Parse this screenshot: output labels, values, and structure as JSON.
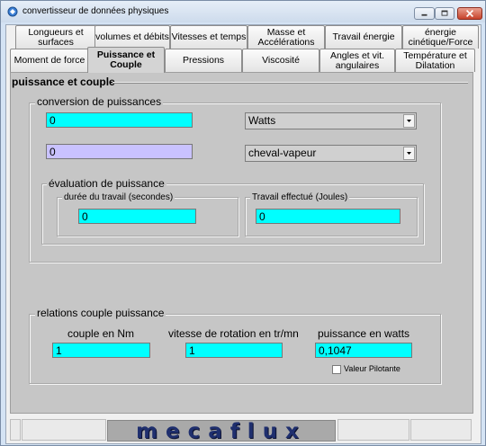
{
  "window": {
    "title": "convertisseur de données physiques",
    "icon": "app-icon",
    "controls": [
      "minimize-icon",
      "maximize-icon",
      "close-icon"
    ]
  },
  "tabs_row1": [
    {
      "label": "Longueurs et\nsurfaces"
    },
    {
      "label": "volumes et débits"
    },
    {
      "label": "Vitesses et temps"
    },
    {
      "label": "Masse et\nAccélérations"
    },
    {
      "label": "Travail énergie"
    },
    {
      "label": "énergie\ncinétique/Force"
    }
  ],
  "tabs_row2": [
    {
      "label": "Moment de force"
    },
    {
      "label": "Puissance et\nCouple",
      "active": true
    },
    {
      "label": "Pressions"
    },
    {
      "label": "Viscosité"
    },
    {
      "label": "Angles et vit.\nangulaires"
    },
    {
      "label": "Température et\nDilatation"
    }
  ],
  "panel": {
    "title": "puissance et couple",
    "conversion": {
      "title": "conversion de puissances",
      "value1": "0",
      "unit1": "Watts",
      "value2": "0",
      "unit2": "cheval-vapeur"
    },
    "evaluation": {
      "title": "évaluation de puissance",
      "duree_label": "durée du travail (secondes)",
      "duree_value": "0",
      "travail_label": "Travail effectué (Joules)",
      "travail_value": "0"
    },
    "relations": {
      "title": "relations couple puissance",
      "couple_label": "couple en Nm",
      "couple_value": "1",
      "vitesse_label": "vitesse de rotation en tr/mn",
      "vitesse_value": "1",
      "puissance_label": "puissance en watts",
      "puissance_value": "0,1047",
      "pilotante_label": "Valeur Pilotante",
      "pilotante_checked": false
    }
  },
  "footer": {
    "logo_text": "mecaflux"
  },
  "colors": {
    "field_cyan": "#00ffff",
    "field_lavender": "#c9c2ff",
    "panel_gray": "#c6c6c6",
    "logo_blue": "#1f2f6e",
    "close_red": "#c7422b"
  }
}
